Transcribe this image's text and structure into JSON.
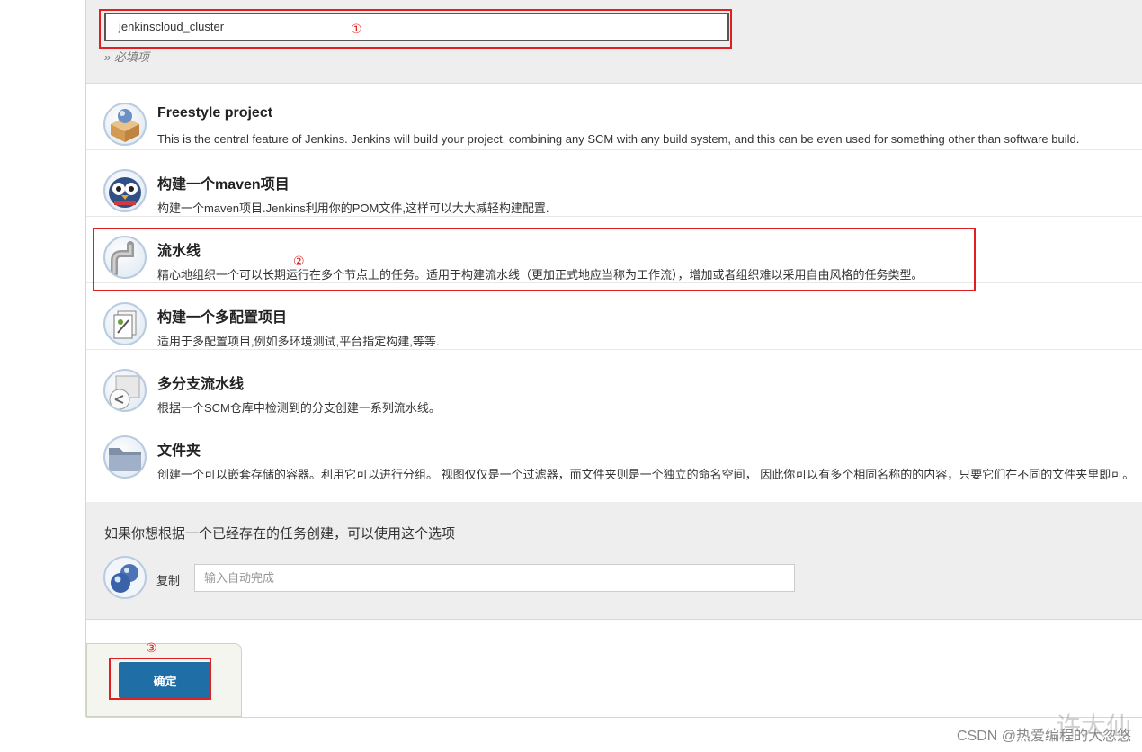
{
  "form": {
    "item_name_value": "jenkinscloud_cluster",
    "required_note": "» 必填项"
  },
  "item_types": [
    {
      "icon": "freestyle-box-icon",
      "title": "Freestyle project",
      "description": "This is the central feature of Jenkins. Jenkins will build your project, combining any SCM with any build system, and this can be even used for something other than software build."
    },
    {
      "icon": "maven-owl-icon",
      "title": "构建一个maven项目",
      "description": "构建一个maven项目.Jenkins利用你的POM文件,这样可以大大减轻构建配置."
    },
    {
      "icon": "pipeline-pipe-icon",
      "title": "流水线",
      "description": "精心地组织一个可以长期运行在多个节点上的任务。适用于构建流水线（更加正式地应当称为工作流），增加或者组织难以采用自由风格的任务类型。"
    },
    {
      "icon": "multi-config-icon",
      "title": "构建一个多配置项目",
      "description": "适用于多配置项目,例如多环境测试,平台指定构建,等等."
    },
    {
      "icon": "multibranch-pipeline-icon",
      "title": "多分支流水线",
      "description": "根据一个SCM仓库中检测到的分支创建一系列流水线。"
    },
    {
      "icon": "folder-icon",
      "title": "文件夹",
      "description": "创建一个可以嵌套存储的容器。利用它可以进行分组。 视图仅仅是一个过滤器，而文件夹则是一个独立的命名空间， 因此你可以有多个相同名称的的内容，只要它们在不同的文件夹里即可。"
    }
  ],
  "copy_section": {
    "heading": "如果你想根据一个已经存在的任务创建，可以使用这个选项",
    "label": "复制",
    "placeholder": "输入自动完成"
  },
  "actions": {
    "ok_label": "确定"
  },
  "annotations": {
    "one": "①",
    "two": "②",
    "three": "③",
    "color": "#e02020"
  },
  "watermark": "CSDN @热爱编程的大忽悠",
  "watermark_big": "许大仙",
  "colors": {
    "button": "#1f6ea5",
    "section_bg": "#eeeeee"
  }
}
